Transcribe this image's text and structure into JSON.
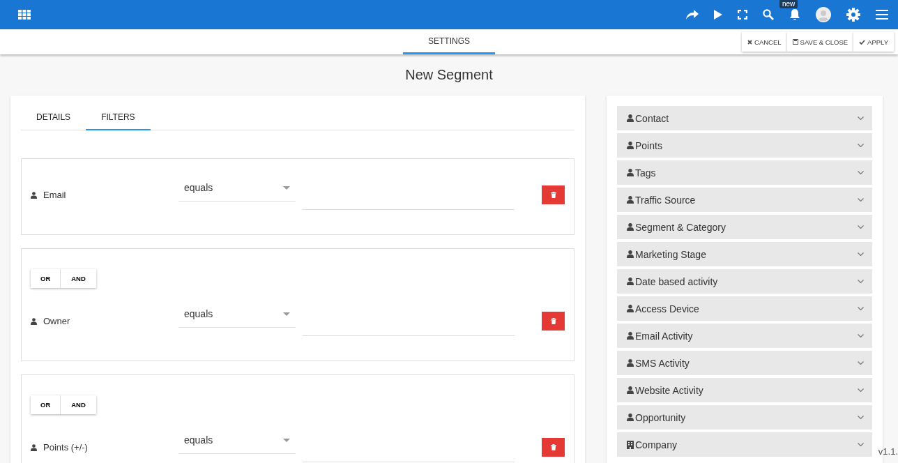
{
  "topbar": {
    "notification_badge": "new"
  },
  "subbar": {
    "tabs": [
      {
        "label": "SETTINGS",
        "selected": true
      }
    ],
    "actions": [
      {
        "label": "CANCEL",
        "kind": "cancel"
      },
      {
        "label": "SAVE & CLOSE",
        "kind": "save"
      },
      {
        "label": "APPLY",
        "kind": "apply"
      }
    ]
  },
  "title": "New Segment",
  "editor": {
    "tabs": [
      {
        "label": "DETAILS",
        "selected": false
      },
      {
        "label": "FILTERS",
        "selected": true
      }
    ],
    "filters": [
      {
        "field": "Email",
        "operator": "equals"
      },
      {
        "connectors": [
          "OR",
          "AND"
        ],
        "field": "Owner",
        "operator": "equals"
      },
      {
        "connectors": [
          "OR",
          "AND"
        ],
        "field": "Points (+/-)",
        "operator": "equals"
      }
    ]
  },
  "categories": [
    {
      "label": "Contact",
      "kind": "person"
    },
    {
      "label": "Points",
      "kind": "person"
    },
    {
      "label": "Tags",
      "kind": "person"
    },
    {
      "label": "Traffic Source",
      "kind": "person"
    },
    {
      "label": "Segment & Category",
      "kind": "person"
    },
    {
      "label": "Marketing Stage",
      "kind": "person"
    },
    {
      "label": "Date based activity",
      "kind": "person"
    },
    {
      "label": "Access Device",
      "kind": "person"
    },
    {
      "label": "Email Activity",
      "kind": "person"
    },
    {
      "label": "SMS Activity",
      "kind": "person"
    },
    {
      "label": "Website Activity",
      "kind": "person"
    },
    {
      "label": "Opportunity",
      "kind": "person"
    },
    {
      "label": "Company",
      "kind": "building"
    }
  ],
  "version": "v1.1."
}
